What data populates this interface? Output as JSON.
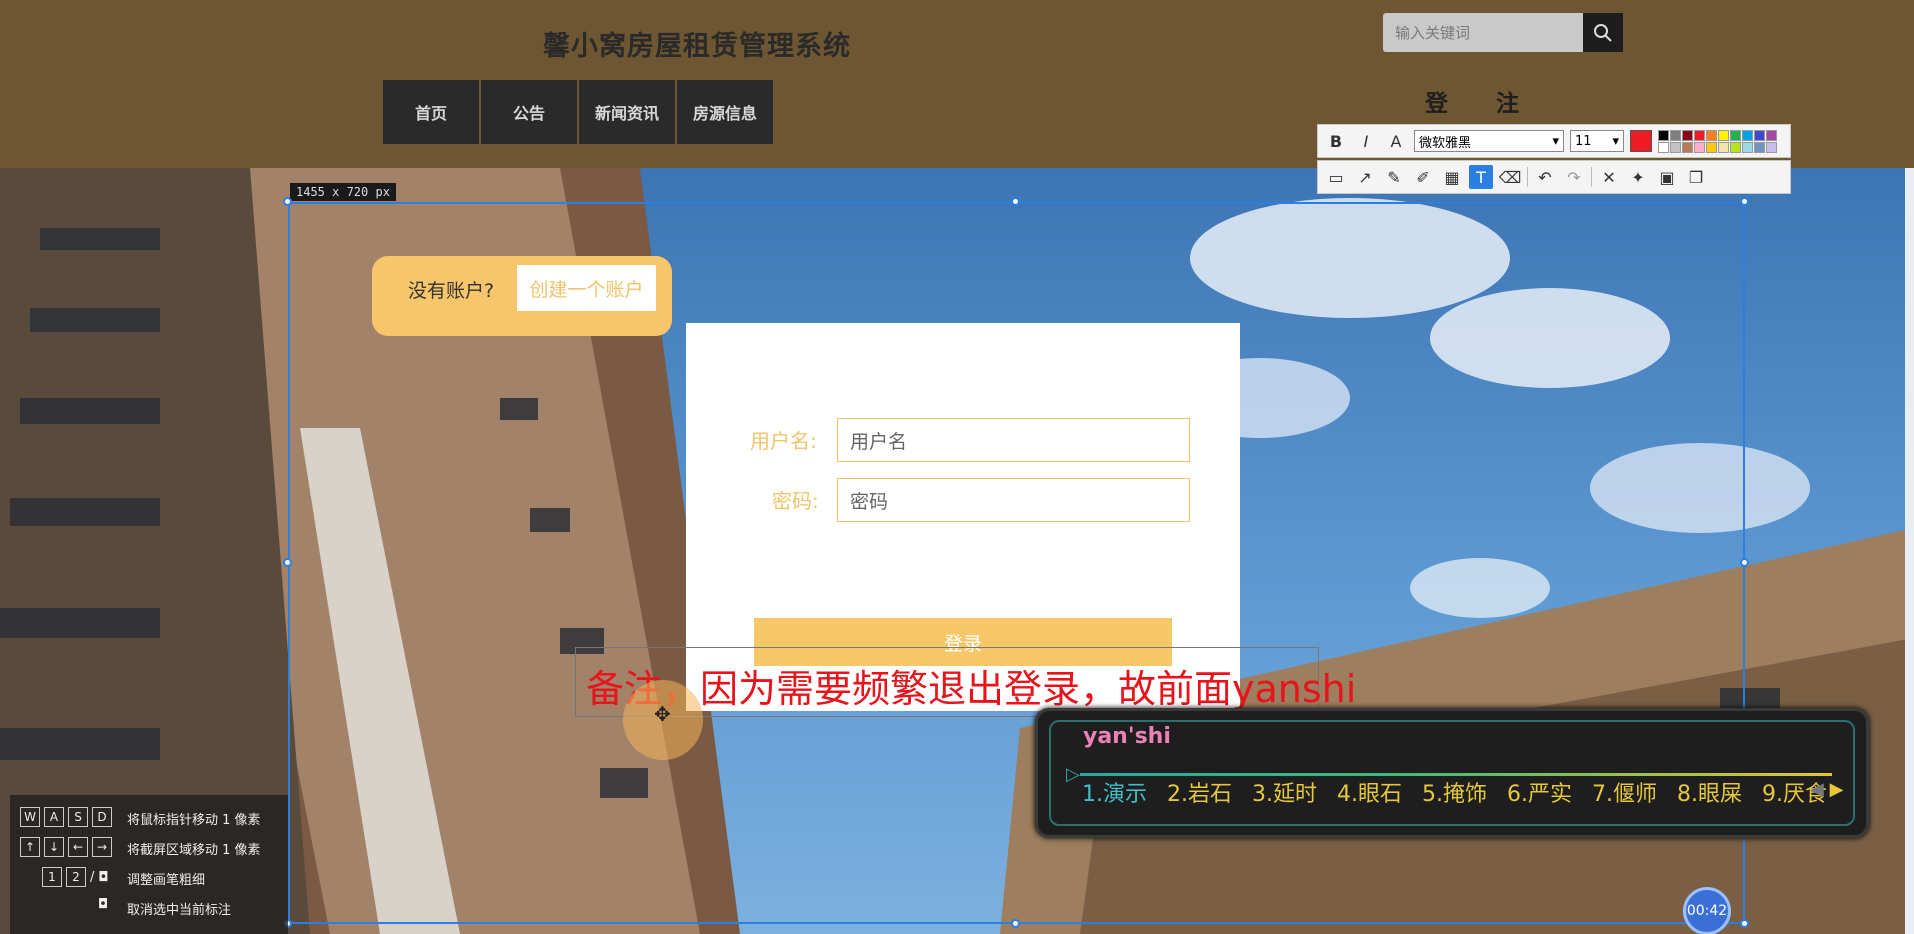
{
  "header": {
    "site_title": "馨小窝房屋租赁管理系统",
    "nav": [
      "首页",
      "公告",
      "新闻资讯",
      "房源信息"
    ],
    "search_placeholder": "输入关键词",
    "login_register": "登 注"
  },
  "screenshot_tool": {
    "selection_size": "1455 x 720  px",
    "font_name": "微软雅黑",
    "font_size": "11",
    "color": "#ee1c24",
    "palette": [
      "#000000",
      "#7f7f7f",
      "#880015",
      "#ed1c24",
      "#ff7f27",
      "#fff200",
      "#22b14c",
      "#00a2e8",
      "#3f48cc",
      "#a349a4",
      "#ffffff",
      "#c3c3c3",
      "#b97a57",
      "#ffaec9",
      "#ffc90e",
      "#efe4b0",
      "#b5e61d",
      "#99d9ea",
      "#7092be",
      "#c8bfe7"
    ],
    "tools": [
      "rect-icon",
      "line-icon",
      "pen-icon",
      "marker-icon",
      "mosaic-icon",
      "text-icon",
      "eraser-icon",
      "undo-icon",
      "redo-icon",
      "close-icon",
      "pin-icon",
      "save-icon",
      "copy-icon"
    ],
    "timer": "00:42"
  },
  "login": {
    "no_account": "没有账户?",
    "create_account": "创建一个账户",
    "username_label": "用户名:",
    "username_placeholder": "用户名",
    "password_label": "密码:",
    "password_placeholder": "密码",
    "login_button": "登录"
  },
  "annotation": {
    "text": "备注，因为需要频繁退出登录，故前面yanshi"
  },
  "ime": {
    "pinyin": "yan'shi",
    "candidates": [
      "1.演示",
      "2.岩石",
      "3.延时",
      "4.眼石",
      "5.掩饰",
      "6.严实",
      "7.偃师",
      "8.眼屎",
      "9.厌食"
    ]
  },
  "shortcuts": [
    {
      "keys": [
        "W",
        "A",
        "S",
        "D"
      ],
      "desc": "将鼠标指针移动 1 像素"
    },
    {
      "keys": [
        "↑",
        "↓",
        "←",
        "→"
      ],
      "desc": "将截屏区域移动 1 像素"
    },
    {
      "keys": [
        "1",
        "2"
      ],
      "desc": "调整画笔粗细"
    },
    {
      "keys": [],
      "desc": "取消选中当前标注"
    }
  ]
}
